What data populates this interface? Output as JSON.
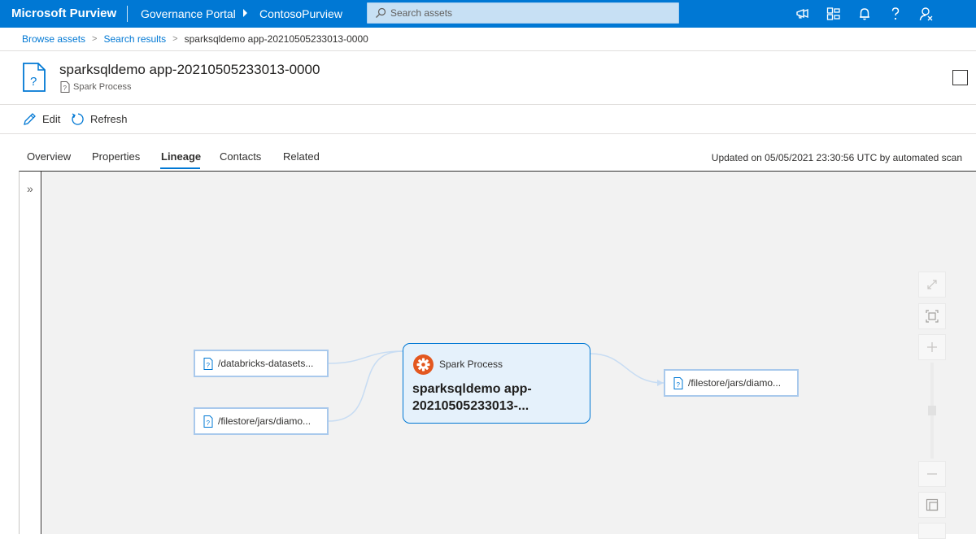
{
  "topbar": {
    "brand": "Microsoft Purview",
    "portal": "Governance Portal",
    "account": "ContosoPurview",
    "search_placeholder": "Search assets",
    "icons": [
      "feedback-icon",
      "directory-icon",
      "notifications-icon",
      "help-icon",
      "profile-icon"
    ]
  },
  "breadcrumb": {
    "items": [
      "Browse assets",
      "Search results"
    ],
    "current": "sparksqldemo app-20210505233013-0000"
  },
  "asset": {
    "title": "sparksqldemo app-20210505233013-0000",
    "type": "Spark Process"
  },
  "commands": {
    "edit": "Edit",
    "refresh": "Refresh"
  },
  "tabs": [
    "Overview",
    "Properties",
    "Lineage",
    "Contacts",
    "Related"
  ],
  "active_tab": "Lineage",
  "updated_text": "Updated on 05/05/2021 23:30:56 UTC by automated scan",
  "lineage": {
    "inputs": [
      "/databricks-datasets...",
      "/filestore/jars/diamo..."
    ],
    "process": {
      "type": "Spark Process",
      "name": "sparksqldemo app-20210505233013-..."
    },
    "outputs": [
      "/filestore/jars/diamo..."
    ],
    "collapse_glyph": "»"
  },
  "colors": {
    "brand_blue": "#0078d4",
    "process_orange": "#e3571f",
    "canvas_bg": "#f2f2f2"
  }
}
